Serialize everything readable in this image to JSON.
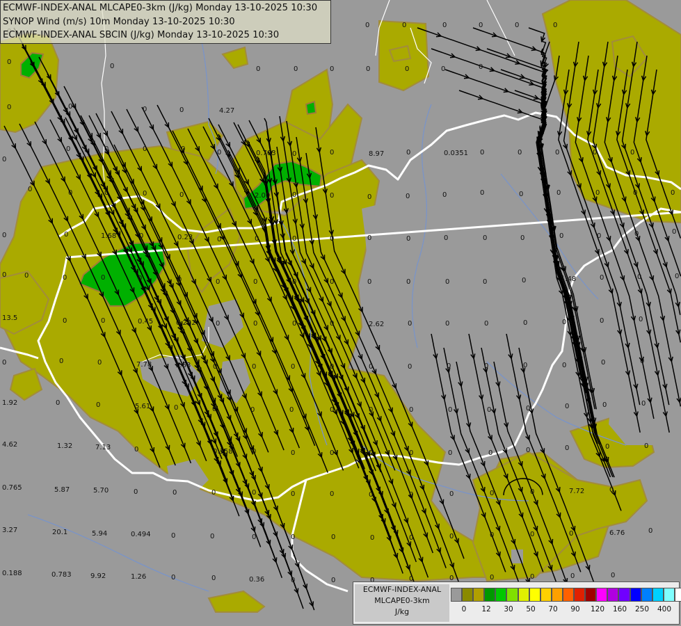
{
  "titles": [
    "ECMWF-INDEX-ANAL MLCAPE0-3km (J/kg) Monday 13-10-2025 10:30",
    "SYNOP Wind (m/s) 10m Monday 13-10-2025 10:30",
    "ECMWF-INDEX-ANAL SBCIN (J/kg) Monday 13-10-2025 10:30"
  ],
  "legend": {
    "title_line1": "ECMWF-INDEX-ANAL",
    "title_line2": "MLCAPE0-3km",
    "unit": "J/kg",
    "colors": [
      "#9a9a9a",
      "#8a8a00",
      "#b0a000",
      "#009800",
      "#00c800",
      "#80e000",
      "#e0f000",
      "#ffff00",
      "#ffd000",
      "#ffa000",
      "#ff6000",
      "#e02000",
      "#a00000",
      "#ff00ff",
      "#b000e0",
      "#7000ff",
      "#0000ff",
      "#0080ff",
      "#00d0ff",
      "#80ffff",
      "#ffffff"
    ],
    "ticks": [
      "0",
      "12",
      "30",
      "50",
      "70",
      "90",
      "120",
      "160",
      "250",
      "400"
    ]
  },
  "palette": {
    "background": "#9a9a9a",
    "olive": "#aaaa00",
    "olive_edge": "#a08c3c",
    "green": "#00b000",
    "border": "#ffffff",
    "river": "#7a94c8",
    "streamline": "#000000"
  },
  "values": [
    [
      "0",
      7,
      8
    ],
    [
      "0",
      10,
      44
    ],
    [
      "0",
      10,
      88
    ],
    [
      "0",
      10,
      153
    ],
    [
      "0",
      3,
      228
    ],
    [
      "0",
      3,
      337
    ],
    [
      "0",
      3,
      394
    ],
    [
      "13.5",
      3,
      456
    ],
    [
      "0",
      3,
      520
    ],
    [
      "1.92",
      3,
      578
    ],
    [
      "4.62",
      3,
      638
    ],
    [
      "0.765",
      3,
      700
    ],
    [
      "3.27",
      3,
      761
    ],
    [
      "0.188",
      3,
      823
    ],
    [
      "0",
      158,
      94
    ],
    [
      "0",
      98,
      152
    ],
    [
      "0",
      205,
      156
    ],
    [
      "0",
      258,
      157
    ],
    [
      "4.27",
      315,
      158
    ],
    [
      "0",
      368,
      98
    ],
    [
      "0",
      422,
      98
    ],
    [
      "0",
      474,
      98
    ],
    [
      "0",
      526,
      98
    ],
    [
      "0",
      582,
      98
    ],
    [
      "0",
      634,
      98
    ],
    [
      "0",
      688,
      95
    ],
    [
      "0",
      525,
      35
    ],
    [
      "0",
      578,
      35
    ],
    [
      "0",
      636,
      35
    ],
    [
      "0",
      688,
      35
    ],
    [
      "0",
      740,
      35
    ],
    [
      "0",
      795,
      35
    ],
    [
      "0",
      95,
      213
    ],
    [
      "0",
      150,
      213
    ],
    [
      "0",
      205,
      213
    ],
    [
      "0",
      260,
      213
    ],
    [
      "0",
      312,
      218
    ],
    [
      "0.703",
      368,
      219
    ],
    [
      "0",
      420,
      220
    ],
    [
      "0",
      474,
      218
    ],
    [
      "8.97",
      530,
      220
    ],
    [
      "0",
      584,
      218
    ],
    [
      "0.0351",
      638,
      219
    ],
    [
      "0",
      690,
      218
    ],
    [
      "0",
      744,
      218
    ],
    [
      "0",
      798,
      218
    ],
    [
      "0",
      852,
      218
    ],
    [
      "0",
      906,
      218
    ],
    [
      "0",
      40,
      271
    ],
    [
      "0",
      98,
      276
    ],
    [
      "0",
      150,
      276
    ],
    [
      "0",
      205,
      277
    ],
    [
      "0",
      258,
      279
    ],
    [
      "2.00",
      366,
      280
    ],
    [
      "0",
      420,
      279
    ],
    [
      "0",
      474,
      280
    ],
    [
      "0",
      528,
      282
    ],
    [
      "0",
      583,
      281
    ],
    [
      "0",
      636,
      279
    ],
    [
      "0",
      690,
      276
    ],
    [
      "0",
      746,
      278
    ],
    [
      "0",
      800,
      276
    ],
    [
      "0",
      856,
      276
    ],
    [
      "0",
      910,
      276
    ],
    [
      "0",
      964,
      276
    ],
    [
      "0",
      92,
      336
    ],
    [
      "1.68",
      145,
      338
    ],
    [
      "0",
      200,
      338
    ],
    [
      "0.23",
      255,
      340
    ],
    [
      "0",
      312,
      343
    ],
    [
      "0",
      366,
      342
    ],
    [
      "0",
      420,
      342
    ],
    [
      "0",
      474,
      342
    ],
    [
      "0",
      528,
      341
    ],
    [
      "0",
      584,
      342
    ],
    [
      "0",
      638,
      341
    ],
    [
      "0",
      694,
      341
    ],
    [
      "0",
      748,
      341
    ],
    [
      "0",
      804,
      338
    ],
    [
      "0",
      858,
      338
    ],
    [
      "0",
      912,
      335
    ],
    [
      "0",
      966,
      332
    ],
    [
      "0",
      35,
      395
    ],
    [
      "0",
      90,
      398
    ],
    [
      "0",
      145,
      398
    ],
    [
      "0",
      198,
      399
    ],
    [
      "0",
      255,
      401
    ],
    [
      "0",
      310,
      404
    ],
    [
      "0",
      364,
      404
    ],
    [
      "0",
      420,
      404
    ],
    [
      "0",
      474,
      404
    ],
    [
      "0",
      528,
      404
    ],
    [
      "0",
      584,
      404
    ],
    [
      "0",
      640,
      404
    ],
    [
      "0",
      694,
      404
    ],
    [
      "0",
      750,
      402
    ],
    [
      "1.48",
      806,
      400
    ],
    [
      "0",
      862,
      398
    ],
    [
      "0",
      916,
      397
    ],
    [
      "0",
      970,
      396
    ],
    [
      "0",
      90,
      460
    ],
    [
      "0",
      145,
      460
    ],
    [
      "0.45",
      198,
      461
    ],
    [
      "0.242",
      253,
      463
    ],
    [
      "0",
      310,
      464
    ],
    [
      "0",
      364,
      464
    ],
    [
      "0",
      420,
      464
    ],
    [
      "0",
      474,
      464
    ],
    [
      "2.62",
      530,
      465
    ],
    [
      "0",
      586,
      464
    ],
    [
      "0",
      640,
      464
    ],
    [
      "0",
      696,
      464
    ],
    [
      "0",
      752,
      463
    ],
    [
      "0",
      808,
      462
    ],
    [
      "0",
      862,
      460
    ],
    [
      "0",
      918,
      458
    ],
    [
      "0",
      85,
      518
    ],
    [
      "0",
      140,
      520
    ],
    [
      "7.78",
      196,
      523
    ],
    [
      "1.68",
      252,
      524
    ],
    [
      "0",
      306,
      526
    ],
    [
      "0",
      362,
      526
    ],
    [
      "0",
      418,
      526
    ],
    [
      "0",
      474,
      526
    ],
    [
      "0",
      530,
      526
    ],
    [
      "0",
      586,
      526
    ],
    [
      "0",
      642,
      525
    ],
    [
      "0",
      696,
      525
    ],
    [
      "0",
      752,
      524
    ],
    [
      "0",
      808,
      524
    ],
    [
      "0",
      864,
      520
    ],
    [
      "0",
      920,
      518
    ],
    [
      "0",
      80,
      578
    ],
    [
      "0",
      138,
      581
    ],
    [
      "5.61",
      194,
      583
    ],
    [
      "0",
      250,
      585
    ],
    [
      "0",
      305,
      587
    ],
    [
      "0",
      360,
      588
    ],
    [
      "0",
      416,
      588
    ],
    [
      "0",
      474,
      588
    ],
    [
      "0",
      530,
      588
    ],
    [
      "0",
      588,
      588
    ],
    [
      "0",
      644,
      588
    ],
    [
      "0",
      700,
      588
    ],
    [
      "0",
      756,
      586
    ],
    [
      "0",
      812,
      583
    ],
    [
      "0",
      866,
      581
    ],
    [
      "0",
      922,
      579
    ],
    [
      "1.32",
      82,
      640
    ],
    [
      "7.13",
      137,
      642
    ],
    [
      "0",
      193,
      645
    ],
    [
      "0.158",
      306,
      648
    ],
    [
      "0",
      362,
      648
    ],
    [
      "0",
      418,
      650
    ],
    [
      "0",
      474,
      650
    ],
    [
      "0",
      530,
      650
    ],
    [
      "0",
      588,
      650
    ],
    [
      "0",
      644,
      650
    ],
    [
      "0",
      702,
      650
    ],
    [
      "0",
      756,
      646
    ],
    [
      "0",
      812,
      643
    ],
    [
      "0",
      870,
      641
    ],
    [
      "0",
      926,
      640
    ],
    [
      "5.87",
      78,
      703
    ],
    [
      "5.70",
      134,
      704
    ],
    [
      "0",
      192,
      706
    ],
    [
      "0",
      248,
      707
    ],
    [
      "0",
      304,
      707
    ],
    [
      "0",
      362,
      707
    ],
    [
      "0",
      418,
      709
    ],
    [
      "0",
      474,
      709
    ],
    [
      "0",
      530,
      710
    ],
    [
      "0",
      588,
      710
    ],
    [
      "0",
      646,
      709
    ],
    [
      "0",
      704,
      708
    ],
    [
      "0",
      762,
      706
    ],
    [
      "7.72",
      818,
      705
    ],
    [
      "0",
      876,
      703
    ],
    [
      "20.1",
      75,
      764
    ],
    [
      "5.94",
      132,
      766
    ],
    [
      "0.494",
      188,
      767
    ],
    [
      "0",
      246,
      769
    ],
    [
      "0",
      302,
      770
    ],
    [
      "0",
      362,
      771
    ],
    [
      "0",
      418,
      771
    ],
    [
      "0",
      476,
      771
    ],
    [
      "0",
      532,
      772
    ],
    [
      "0",
      588,
      772
    ],
    [
      "0",
      646,
      770
    ],
    [
      "0",
      704,
      768
    ],
    [
      "0",
      762,
      767
    ],
    [
      "0",
      818,
      766
    ],
    [
      "6.76",
      876,
      765
    ],
    [
      "0",
      932,
      762
    ],
    [
      "0.783",
      74,
      825
    ],
    [
      "9.92",
      130,
      827
    ],
    [
      "1.26",
      188,
      828
    ],
    [
      "0",
      246,
      829
    ],
    [
      "0",
      304,
      830
    ],
    [
      "0.36",
      358,
      832
    ],
    [
      "0",
      418,
      833
    ],
    [
      "0",
      476,
      833
    ],
    [
      "0",
      532,
      833
    ],
    [
      "0",
      588,
      831
    ],
    [
      "0",
      646,
      830
    ],
    [
      "0",
      704,
      829
    ],
    [
      "0",
      762,
      828
    ],
    [
      "0",
      820,
      827
    ],
    [
      "0",
      878,
      826
    ]
  ]
}
